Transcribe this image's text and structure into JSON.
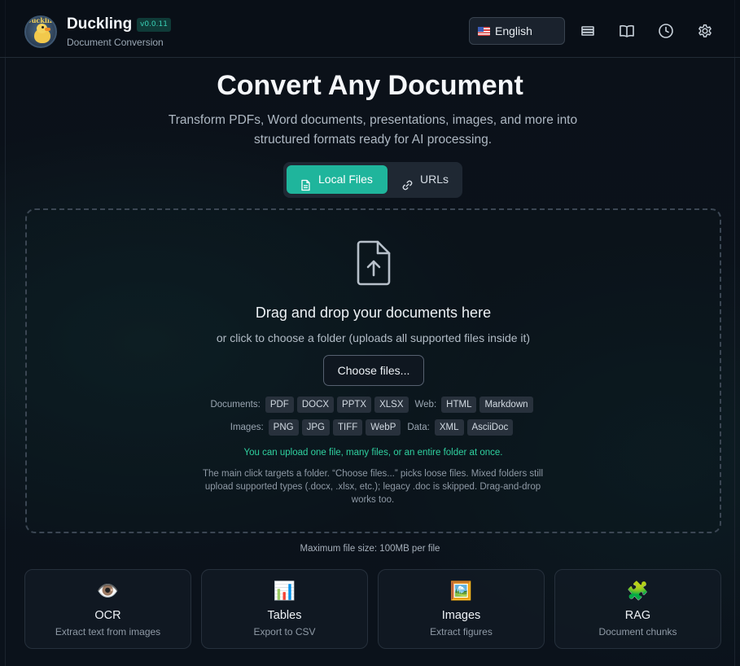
{
  "header": {
    "brand_title": "Duckling",
    "version": "v0.0.11",
    "subtitle": "Document Conversion",
    "logo_text": "Duckling",
    "language": "English",
    "icons": [
      "storage-icon",
      "book-icon",
      "history-icon",
      "settings-icon"
    ]
  },
  "hero": {
    "title": "Convert Any Document",
    "subtitle": "Transform PDFs, Word documents, presentations, images, and more into structured formats ready for AI processing."
  },
  "tabs": [
    {
      "label": "Local Files",
      "icon": "file-icon",
      "active": true
    },
    {
      "label": "URLs",
      "icon": "link-icon",
      "active": false
    }
  ],
  "dropzone": {
    "icon": "file-upload-icon",
    "title": "Drag and drop your documents here",
    "subtitle": "or click to choose a folder (uploads all supported files inside it)",
    "choose_label": "Choose files...",
    "formats_row1": {
      "documents_label": "Documents:",
      "documents": [
        "PDF",
        "DOCX",
        "PPTX",
        "XLSX"
      ],
      "web_label": "Web:",
      "web": [
        "HTML",
        "Markdown"
      ]
    },
    "formats_row2": {
      "images_label": "Images:",
      "images": [
        "PNG",
        "JPG",
        "TIFF",
        "WebP"
      ],
      "data_label": "Data:",
      "data": [
        "XML",
        "AsciiDoc"
      ]
    },
    "tip_green": "You can upload one file, many files, or an entire folder at once.",
    "tip_grey": "The main click targets a folder. “Choose files...” picks loose files. Mixed folders still upload supported types (.docx, .xlsx, etc.); legacy .doc is skipped. Drag-and-drop works too."
  },
  "max_size": "Maximum file size: 100MB per file",
  "features": [
    {
      "emoji": "👁️",
      "title": "OCR",
      "subtitle": "Extract text from images"
    },
    {
      "emoji": "📊",
      "title": "Tables",
      "subtitle": "Export to CSV"
    },
    {
      "emoji": "🖼️",
      "title": "Images",
      "subtitle": "Extract figures"
    },
    {
      "emoji": "🧩",
      "title": "RAG",
      "subtitle": "Document chunks"
    }
  ],
  "colors": {
    "accent": "#1fb59c",
    "green_text": "#2fd09f",
    "background": "#0b1119"
  }
}
